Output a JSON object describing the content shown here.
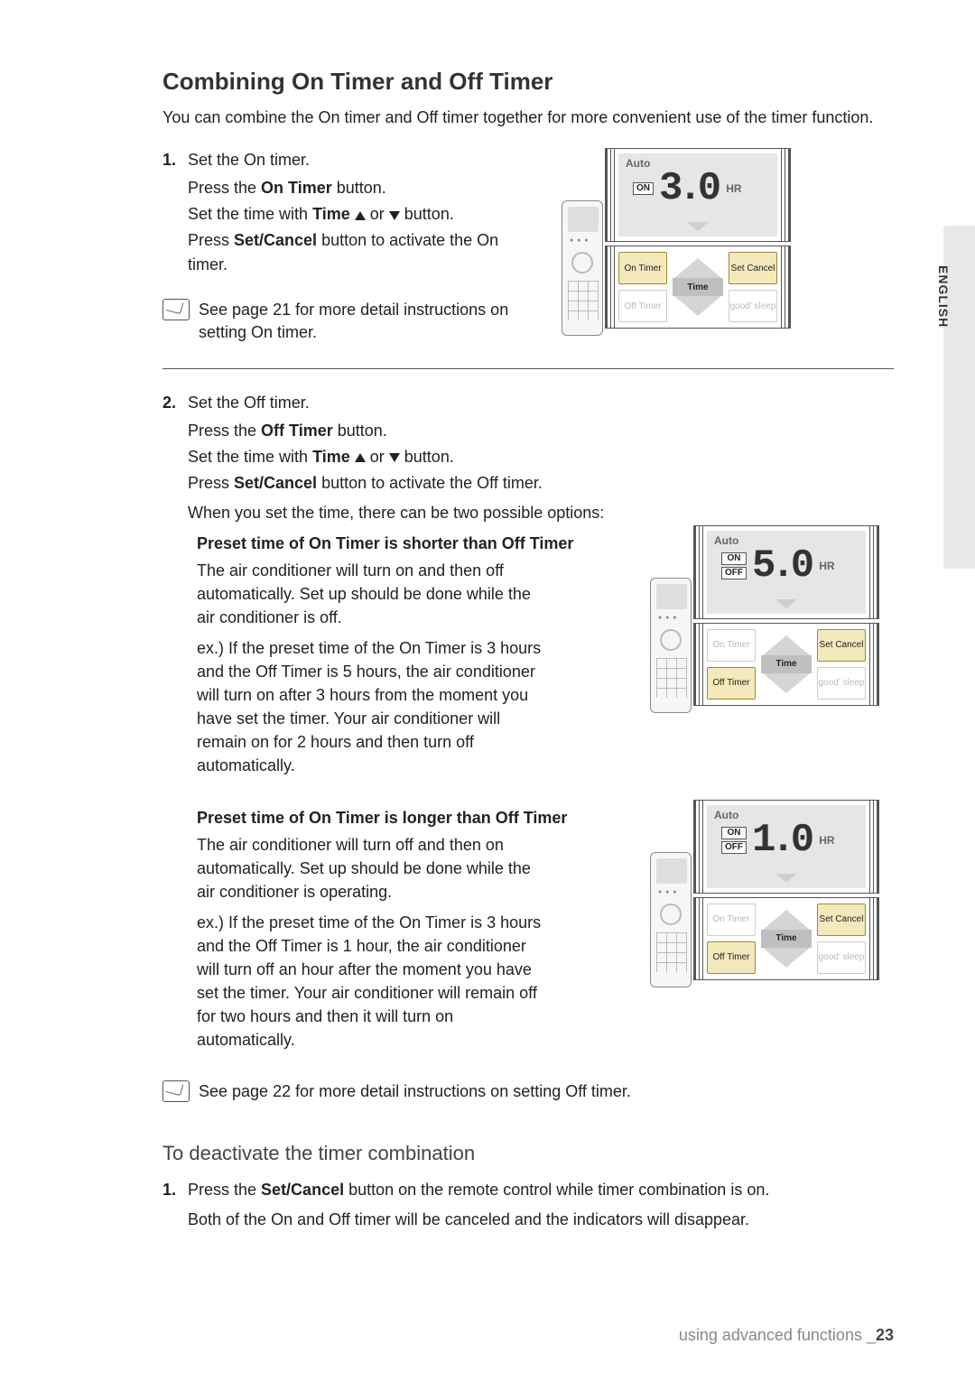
{
  "headings": {
    "main": "Combining On Timer and Off Timer",
    "intro": "You can combine the On timer and Off timer together for more convenient use of the timer function.",
    "deactivate": "To deactivate the timer combination"
  },
  "side_tab": "ENGLISH",
  "steps": {
    "one": {
      "num": "1.",
      "title": "Set the On timer.",
      "lines": [
        "Press the ",
        "On Timer",
        " button.",
        "Set the time with ",
        "Time",
        " or ",
        " button.",
        "Press ",
        "Set/Cancel",
        " button to activate the On timer."
      ]
    },
    "note1": "See page 21 for more detail instructions on setting On timer.",
    "two": {
      "num": "2.",
      "title": "Set the Off timer.",
      "lines": [
        "Press the ",
        "Off Timer",
        " button.",
        "Set the time with ",
        "Time",
        " or ",
        " button.",
        "Press ",
        "Set/Cancel",
        " button to activate the Off timer."
      ],
      "options_lead": "When you set the time, there can be two possible options:"
    },
    "sc1": {
      "title": "Preset time of On Timer is shorter than Off Timer",
      "p1": "The air conditioner will turn on and then off automatically. Set up should be done while the air conditioner is off.",
      "p2": "ex.) If the preset time of the On Timer is 3 hours and the Off Timer is 5 hours, the air conditioner will turn on after 3 hours from the moment you have set the timer. Your air conditioner will remain on for 2 hours and then turn off automatically."
    },
    "sc2": {
      "title": "Preset time of On Timer is longer than Off Timer",
      "p1": "The air conditioner will turn off and then on automatically. Set up should be done while the air conditioner is operating.",
      "p2": "ex.) If the preset time of the On Timer is 3 hours and the Off Timer is 1 hour, the air conditioner will turn off an hour after the moment you have set the timer. Your air conditioner will remain off for two hours and then it will turn on automatically."
    },
    "note2": "See page 22 for more detail instructions on setting Off timer."
  },
  "deactivate_steps": {
    "one": {
      "num": "1.",
      "text_a": "Press the ",
      "text_bold": "Set/Cancel",
      "text_b": " button on the remote control while timer combination is on."
    },
    "result": "Both of the On and Off timer will be canceled and the indicators will disappear."
  },
  "diagrams": {
    "d1": {
      "auto": "Auto",
      "badges": [
        "ON"
      ],
      "digits": "3.0",
      "hr": "HR",
      "btns": {
        "on": "On Timer",
        "set": "Set Cancel",
        "time": "Time",
        "off": "Off Timer",
        "sleep": "good' sleep"
      },
      "on_state": "highlight",
      "set_state": "highlight",
      "off_state": "dim",
      "sleep_state": "dim"
    },
    "d2": {
      "auto": "Auto",
      "badges": [
        "ON",
        "OFF"
      ],
      "digits": "5.0",
      "hr": "HR",
      "btns": {
        "on": "On Timer",
        "set": "Set Cancel",
        "time": "Time",
        "off": "Off Timer",
        "sleep": "good' sleep"
      },
      "on_state": "dim",
      "set_state": "highlight",
      "off_state": "highlight",
      "sleep_state": "dim"
    },
    "d3": {
      "auto": "Auto",
      "badges": [
        "ON",
        "OFF"
      ],
      "digits": "1.0",
      "hr": "HR",
      "btns": {
        "on": "On Timer",
        "set": "Set Cancel",
        "time": "Time",
        "off": "Off Timer",
        "sleep": "good' sleep"
      },
      "on_state": "dim",
      "set_state": "highlight",
      "off_state": "highlight",
      "sleep_state": "dim"
    }
  },
  "footer": {
    "text": "using advanced functions _",
    "page": "23"
  }
}
